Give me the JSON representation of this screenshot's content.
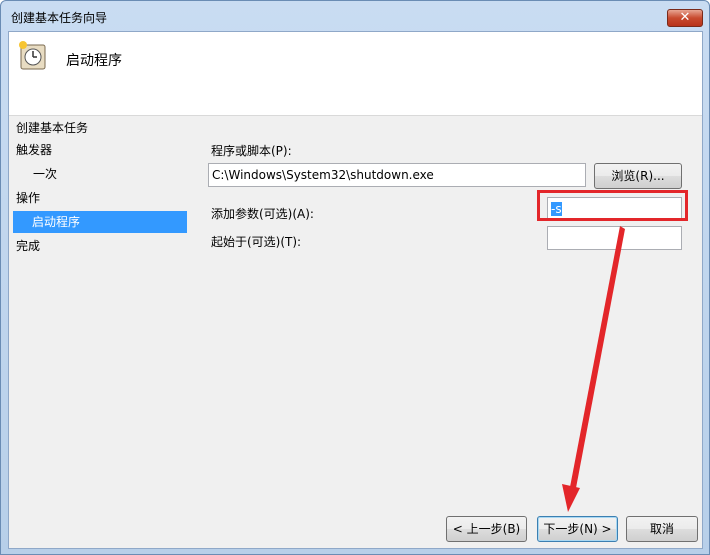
{
  "window": {
    "title": "创建基本任务向导",
    "close_label": "✕"
  },
  "header": {
    "title": "启动程序",
    "icon": "clock-icon"
  },
  "nav": {
    "items": [
      {
        "label": "创建基本任务"
      },
      {
        "label": "触发器"
      },
      {
        "label": "一次"
      },
      {
        "label": "操作"
      },
      {
        "label": "启动程序"
      },
      {
        "label": "完成"
      }
    ]
  },
  "form": {
    "program_label": "程序或脚本(P):",
    "program_value": "C:\\Windows\\System32\\shutdown.exe",
    "browse_label": "浏览(R)...",
    "args_label": "添加参数(可选)(A):",
    "args_value": "-s",
    "start_in_label": "起始于(可选)(T):",
    "start_in_value": ""
  },
  "buttons": {
    "back": "< 上一步(B)",
    "next": "下一步(N) >",
    "cancel": "取消"
  },
  "colors": {
    "annotation": "#e3262a",
    "selection": "#3399ff"
  }
}
